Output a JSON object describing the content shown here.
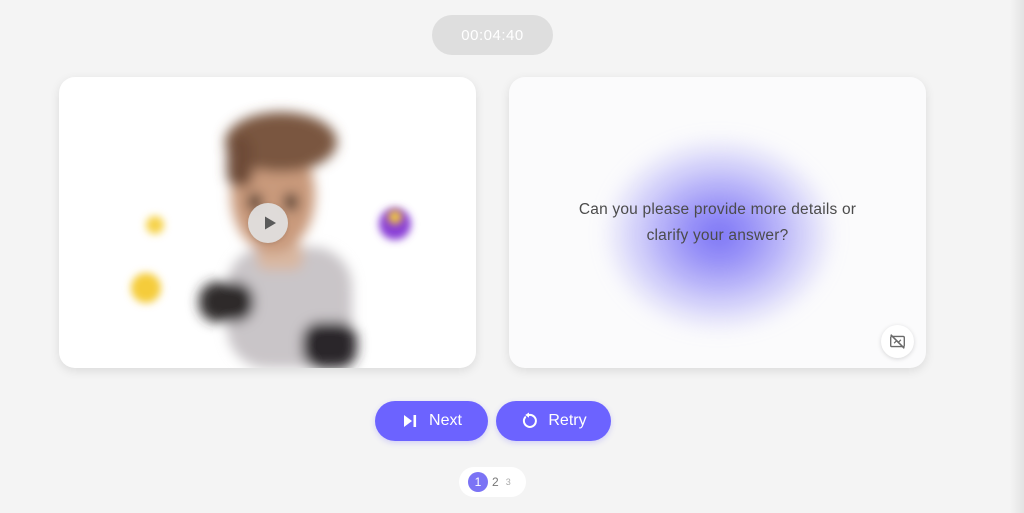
{
  "timer": {
    "text": "00:04:40"
  },
  "video_card": {
    "play_icon": "play-icon",
    "avatar": "blurred-avatar"
  },
  "question_card": {
    "line1": "Can you please provide more details or",
    "line2": "clarify your answer?",
    "camera_icon": "camera-off-icon"
  },
  "actions": {
    "next_label": "Next",
    "next_icon": "skip-next-icon",
    "retry_label": "Retry",
    "retry_icon": "retry-icon"
  },
  "pagination": {
    "pages": [
      "1",
      "2",
      "3"
    ],
    "current": "1"
  },
  "colors": {
    "accent": "#6c63ff",
    "background": "#f4f4f4",
    "timer_bg": "#dedede"
  }
}
